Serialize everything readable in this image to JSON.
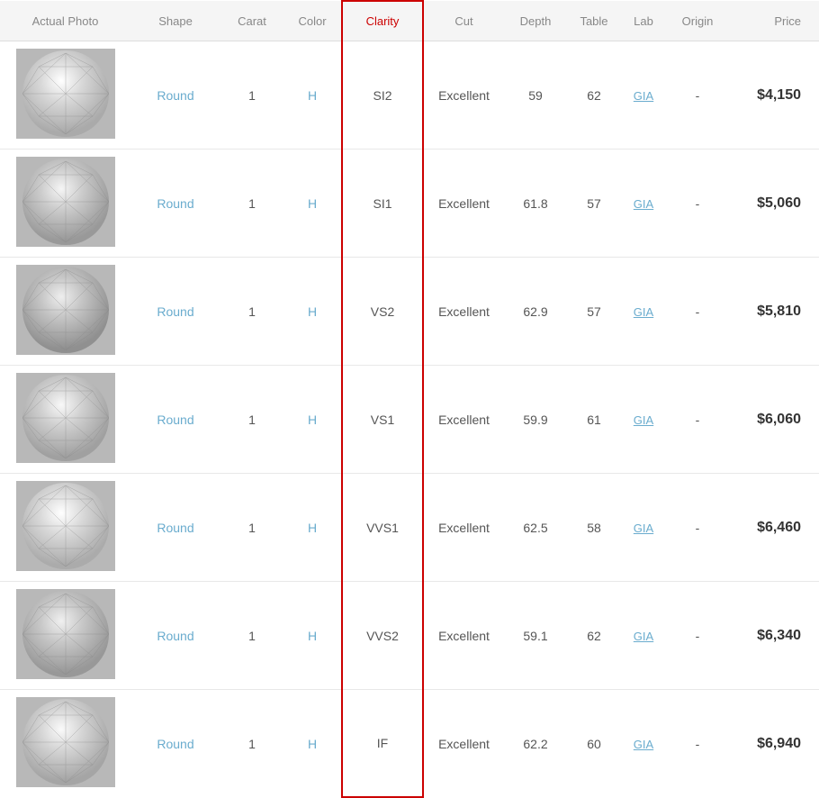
{
  "headers": {
    "photo": "Actual Photo",
    "shape": "Shape",
    "carat": "Carat",
    "color": "Color",
    "clarity": "Clarity",
    "cut": "Cut",
    "depth": "Depth",
    "table": "Table",
    "lab": "Lab",
    "origin": "Origin",
    "price": "Price"
  },
  "rows": [
    {
      "shape": "Round",
      "carat": "1",
      "color": "H",
      "clarity": "SI2",
      "cut": "Excellent",
      "depth": "59",
      "table": "62",
      "lab": "GIA",
      "origin": "-",
      "price": "$4,150"
    },
    {
      "shape": "Round",
      "carat": "1",
      "color": "H",
      "clarity": "SI1",
      "cut": "Excellent",
      "depth": "61.8",
      "table": "57",
      "lab": "GIA",
      "origin": "-",
      "price": "$5,060"
    },
    {
      "shape": "Round",
      "carat": "1",
      "color": "H",
      "clarity": "VS2",
      "cut": "Excellent",
      "depth": "62.9",
      "table": "57",
      "lab": "GIA",
      "origin": "-",
      "price": "$5,810"
    },
    {
      "shape": "Round",
      "carat": "1",
      "color": "H",
      "clarity": "VS1",
      "cut": "Excellent",
      "depth": "59.9",
      "table": "61",
      "lab": "GIA",
      "origin": "-",
      "price": "$6,060"
    },
    {
      "shape": "Round",
      "carat": "1",
      "color": "H",
      "clarity": "VVS1",
      "cut": "Excellent",
      "depth": "62.5",
      "table": "58",
      "lab": "GIA",
      "origin": "-",
      "price": "$6,460"
    },
    {
      "shape": "Round",
      "carat": "1",
      "color": "H",
      "clarity": "VVS2",
      "cut": "Excellent",
      "depth": "59.1",
      "table": "62",
      "lab": "GIA",
      "origin": "-",
      "price": "$6,340"
    },
    {
      "shape": "Round",
      "carat": "1",
      "color": "H",
      "clarity": "IF",
      "cut": "Excellent",
      "depth": "62.2",
      "table": "60",
      "lab": "GIA",
      "origin": "-",
      "price": "$6,940"
    }
  ],
  "colors": {
    "accent": "#6aacce",
    "red_border": "#cc0000",
    "header_bg": "#f5f5f5",
    "row_border": "#e8e8e8"
  }
}
